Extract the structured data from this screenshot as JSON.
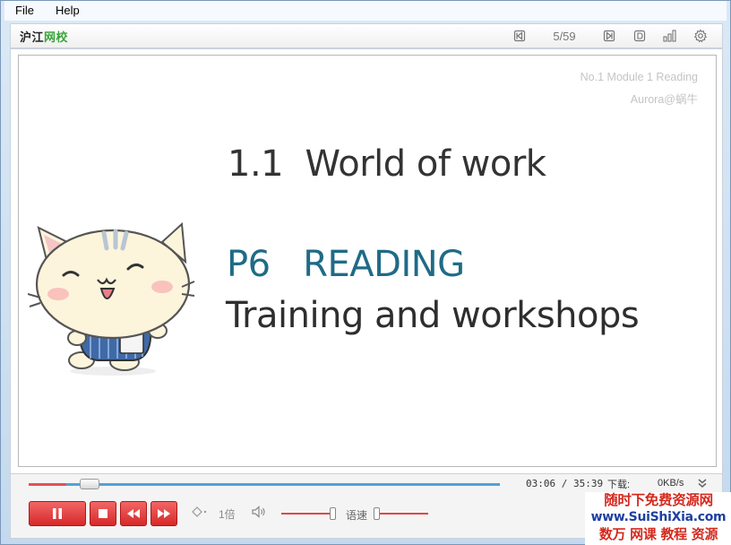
{
  "menu": {
    "file": "File",
    "help": "Help"
  },
  "toolbar": {
    "logo_black": "沪江",
    "logo_green": "网校",
    "page_counter": "5/59",
    "icons": [
      "prev-page-icon",
      "next-page-icon",
      "document-icon",
      "stats-icon",
      "settings-icon"
    ]
  },
  "slide": {
    "meta_line1": "No.1 Module 1 Reading",
    "meta_line2": "Aurora@蜗牛",
    "title": "1.1  World of work",
    "subtitle": "P6   READING",
    "subtitle2": "Training and workshops"
  },
  "player": {
    "progress": 0.08,
    "time": "03:06 / 35:39",
    "download_label": "下载:",
    "download_speed": "0KB/s",
    "speed_multiplier": "1倍",
    "rate_label": "语速",
    "volume": 0.98,
    "rate": 0.0
  },
  "watermark": {
    "line1": "随时下免费资源网",
    "line2": "www.SuiShiXia.com",
    "line3": "数万 网课 教程 资源"
  },
  "colors": {
    "accent_red": "#d62828",
    "progress_blue": "#4fa3d8",
    "subtitle_teal": "#1f6b86"
  }
}
